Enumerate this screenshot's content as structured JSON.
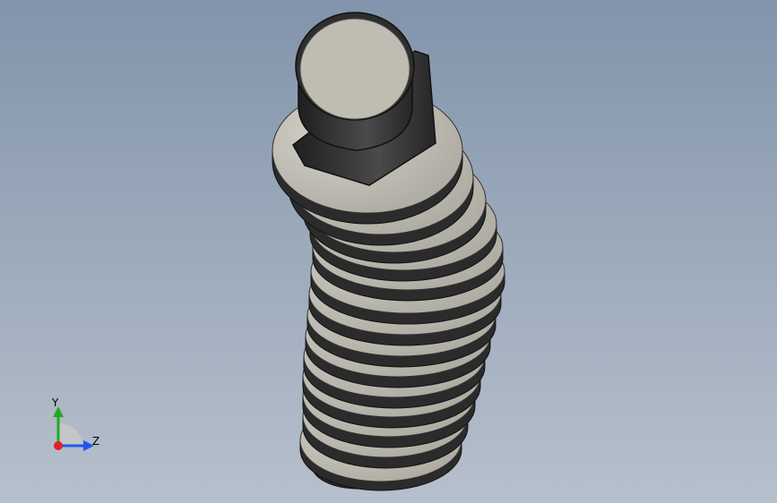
{
  "viewport": {
    "background_top": "#8294ab",
    "background_bottom": "#b7c0cc"
  },
  "model": {
    "name": "bent-bolt-with-washer-stack",
    "disc_face_color": "#c3c1b5",
    "disc_edge_color": "#2b2b2b",
    "bolt_head_color": "#3c3c3c",
    "end_cap_color": "#ffffff"
  },
  "triad": {
    "y_label": "Y",
    "z_label": "Z",
    "y_color": "#22aa22",
    "z_color": "#2255ee",
    "origin_color": "#dd2222",
    "arc_icon": "view-rotation-arc-icon"
  }
}
